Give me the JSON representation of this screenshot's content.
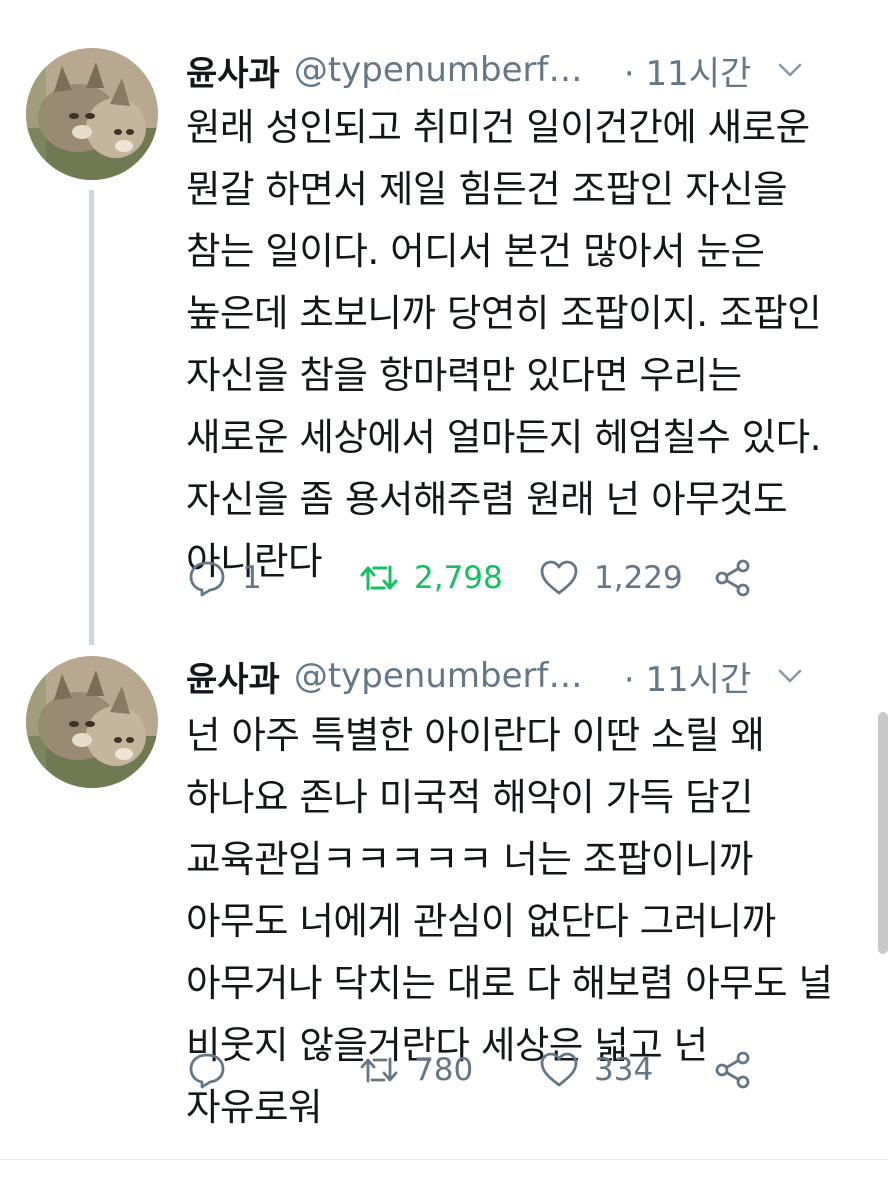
{
  "tweets": [
    {
      "name": "윤사과",
      "handle": "@typenumberf…",
      "time": "· 11시간",
      "text_lines": [
        "원래 성인되고 취미건 일이건간에 새로운",
        "뭔갈 하면서 제일 힘든건 조팝인 자신을",
        "참는 일이다. 어디서 본건 많아서 눈은",
        "높은데 초보니까 당연히 조팝이지. 조팝인",
        "자신을 참을 항마력만 있다면 우리는",
        "새로운 세상에서 얼마든지 헤엄칠수 있다.",
        "자신을 좀 용서해주렴 원래 넌 아무것도",
        "아니란다"
      ],
      "replies": "1",
      "retweets": "2,798",
      "likes": "1,229",
      "retweeted": true
    },
    {
      "name": "윤사과",
      "handle": "@typenumberf…",
      "time": "· 11시간",
      "text_lines": [
        "넌 아주 특별한 아이란다 이딴 소릴 왜",
        "하나요 존나 미국적 해악이 가득 담긴",
        "교육관임ㅋㅋㅋㅋㅋ 너는 조팝이니까",
        "아무도 너에게 관심이 없단다 그러니까",
        "아무거나 닥치는 대로 다 해보렴 아무도 널",
        "비웃지 않을거란다 세상은 넓고 넌",
        "자유로워"
      ],
      "replies": "",
      "retweets": "780",
      "likes": "334",
      "retweeted": false
    }
  ],
  "icons": {
    "reply": "reply-icon",
    "retweet": "retweet-icon",
    "like": "heart-icon",
    "share": "share-icon",
    "caret": "chevron-down-icon",
    "avatar": "lynx-avatar"
  },
  "colors": {
    "text": "#14171a",
    "secondary": "#657786",
    "retweet_active": "#17bf63",
    "thread_line": "#ccd6dd"
  }
}
